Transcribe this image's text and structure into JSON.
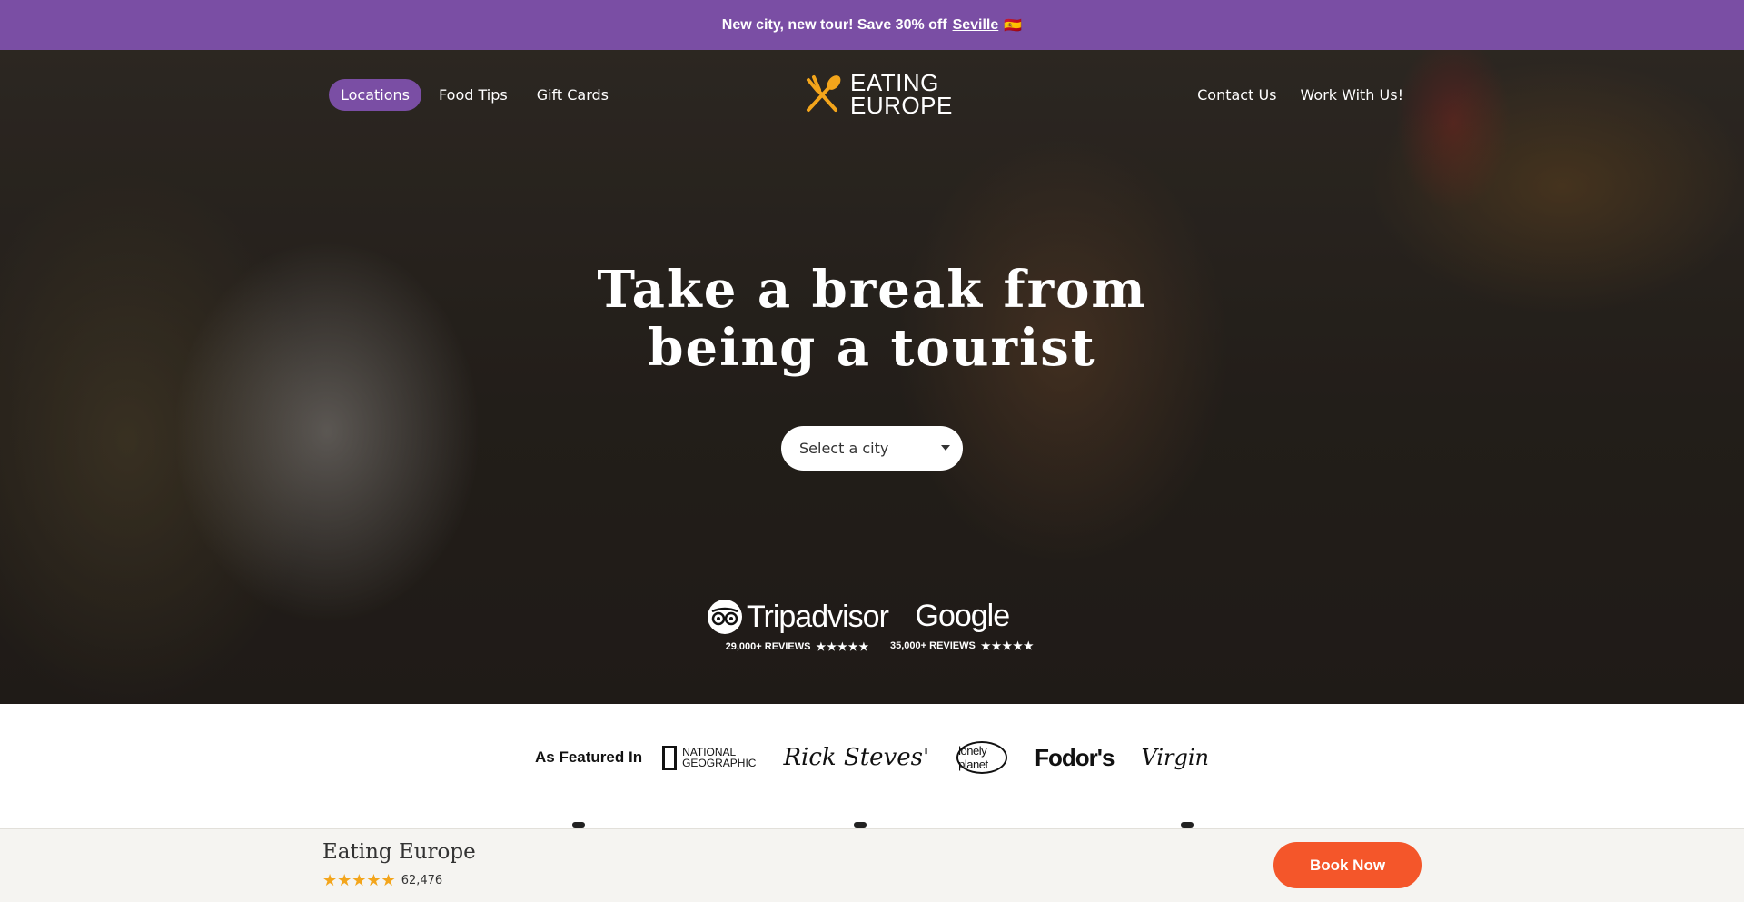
{
  "promo": {
    "text": "New city, new tour! Save 30% off",
    "link": "Seville",
    "emoji": "🇪🇸",
    "background": "#7a4ea4"
  },
  "nav": {
    "left": [
      "Locations",
      "Food Tips",
      "Gift Cards"
    ],
    "right": [
      "Contact Us",
      "Work With Us!"
    ],
    "active": "Locations"
  },
  "logo": {
    "line1": "EATING",
    "line2": "EUROPE",
    "icon": "fork-spoon-icon",
    "accent": "#f3a51b"
  },
  "hero": {
    "headline_line1": "Take a break from",
    "headline_line2": "being a tourist",
    "select_placeholder": "Select a city"
  },
  "reviews": [
    {
      "brand": "Tripadvisor",
      "count": "29,000+ REVIEWS",
      "stars": "★★★★★"
    },
    {
      "brand": "Google",
      "count": "35,000+ REVIEWS",
      "stars": "★★★★★"
    }
  ],
  "featured": {
    "label": "As Featured In",
    "logos": [
      "NATIONAL GEOGRAPHIC",
      "Rick Steves'",
      "lonely planet",
      "Fodor's",
      "Virgin"
    ],
    "natgeo_line1": "NATIONAL",
    "natgeo_line2": "GEOGRAPHIC"
  },
  "bottom_bar": {
    "name": "Eating Europe",
    "stars": "★★★★★",
    "rating_count": "62,476",
    "cta": "Book Now",
    "cta_color": "#f4562a"
  }
}
